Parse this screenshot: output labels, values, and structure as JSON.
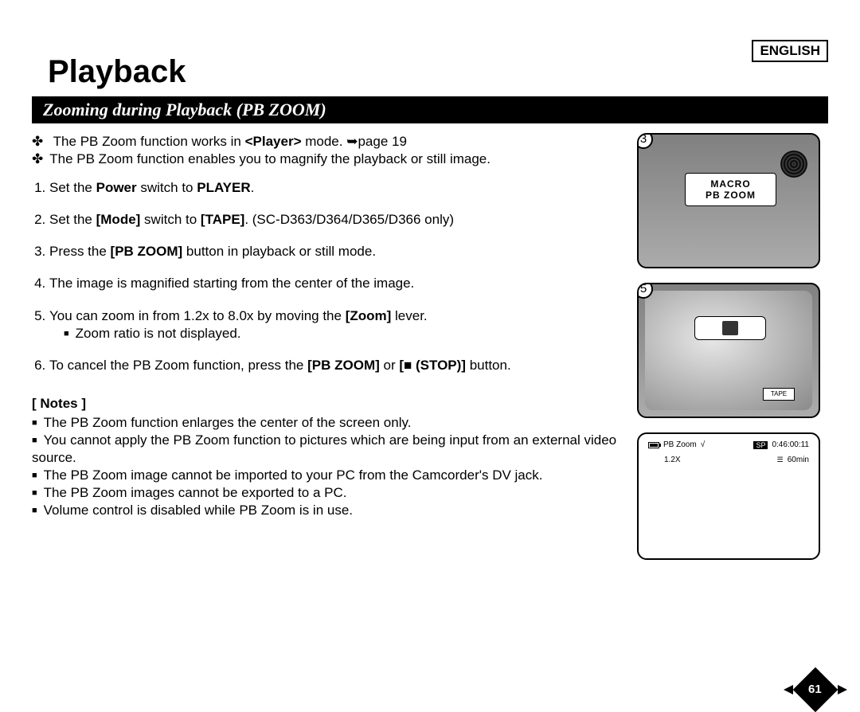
{
  "language": "ENGLISH",
  "title": "Playback",
  "section": "Zooming during Playback (PB ZOOM)",
  "intro": {
    "line1a": "The PB Zoom function works in ",
    "line1b": "<Player>",
    "line1c": " mode. ➥page 19",
    "line2": "The PB Zoom function enables you to magnify the playback or still image."
  },
  "steps": {
    "s1a": "Set the ",
    "s1b": "Power",
    "s1c": " switch to ",
    "s1d": "PLAYER",
    "s1e": ".",
    "s2a": "Set the ",
    "s2b": "[Mode]",
    "s2c": " switch to ",
    "s2d": "[TAPE]",
    "s2e": ". (SC-D363/D364/D365/D366 only)",
    "s3a": "Press the ",
    "s3b": "[PB ZOOM]",
    "s3c": " button in playback or still mode.",
    "s4": "The image is magnified starting from the center of the image.",
    "s5a": "You can zoom in from 1.2x to 8.0x by moving the ",
    "s5b": "[Zoom]",
    "s5c": " lever.",
    "s5sub": "Zoom ratio is not displayed.",
    "s6a": "To cancel the PB Zoom function, press the ",
    "s6b": "[PB ZOOM]",
    "s6c": " or ",
    "s6d": "[■ (STOP)]",
    "s6e": " button."
  },
  "notesHeading": "[ Notes ]",
  "notes": {
    "n1": "The PB Zoom function enlarges the center of the screen only.",
    "n2": "You cannot apply the PB Zoom function to pictures which are being input from an external video source.",
    "n3": "The PB Zoom image cannot be imported to your PC from the Camcorder's DV jack.",
    "n4": "The PB Zoom images cannot be exported to a PC.",
    "n5": "Volume control is disabled while PB Zoom is in use."
  },
  "fig3num": "3",
  "fig5num": "5",
  "macroLabel1": "MACRO",
  "macroLabel2": "PB ZOOM",
  "tapeLabel": "TAPE",
  "lcd": {
    "pbzoom": "PB Zoom",
    "play": "√",
    "sp": "SP",
    "time": "0:46:00:11",
    "zoomx": "1.2X",
    "remain": "60min"
  },
  "pageNum": "61"
}
